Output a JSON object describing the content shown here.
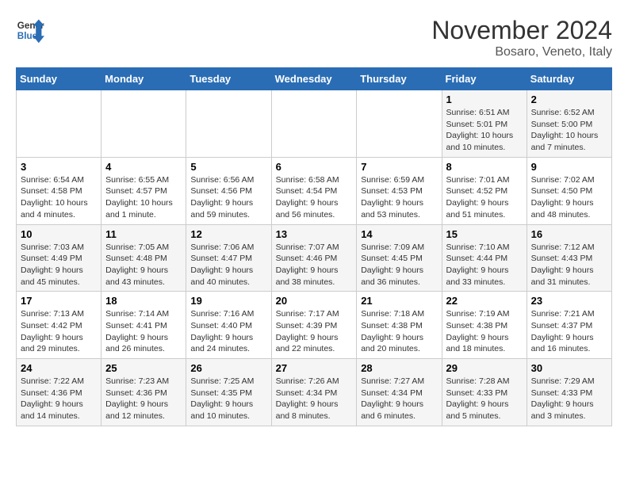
{
  "header": {
    "logo_line1": "General",
    "logo_line2": "Blue",
    "month": "November 2024",
    "location": "Bosaro, Veneto, Italy"
  },
  "weekdays": [
    "Sunday",
    "Monday",
    "Tuesday",
    "Wednesday",
    "Thursday",
    "Friday",
    "Saturday"
  ],
  "weeks": [
    [
      {
        "day": "",
        "info": ""
      },
      {
        "day": "",
        "info": ""
      },
      {
        "day": "",
        "info": ""
      },
      {
        "day": "",
        "info": ""
      },
      {
        "day": "",
        "info": ""
      },
      {
        "day": "1",
        "info": "Sunrise: 6:51 AM\nSunset: 5:01 PM\nDaylight: 10 hours and 10 minutes."
      },
      {
        "day": "2",
        "info": "Sunrise: 6:52 AM\nSunset: 5:00 PM\nDaylight: 10 hours and 7 minutes."
      }
    ],
    [
      {
        "day": "3",
        "info": "Sunrise: 6:54 AM\nSunset: 4:58 PM\nDaylight: 10 hours and 4 minutes."
      },
      {
        "day": "4",
        "info": "Sunrise: 6:55 AM\nSunset: 4:57 PM\nDaylight: 10 hours and 1 minute."
      },
      {
        "day": "5",
        "info": "Sunrise: 6:56 AM\nSunset: 4:56 PM\nDaylight: 9 hours and 59 minutes."
      },
      {
        "day": "6",
        "info": "Sunrise: 6:58 AM\nSunset: 4:54 PM\nDaylight: 9 hours and 56 minutes."
      },
      {
        "day": "7",
        "info": "Sunrise: 6:59 AM\nSunset: 4:53 PM\nDaylight: 9 hours and 53 minutes."
      },
      {
        "day": "8",
        "info": "Sunrise: 7:01 AM\nSunset: 4:52 PM\nDaylight: 9 hours and 51 minutes."
      },
      {
        "day": "9",
        "info": "Sunrise: 7:02 AM\nSunset: 4:50 PM\nDaylight: 9 hours and 48 minutes."
      }
    ],
    [
      {
        "day": "10",
        "info": "Sunrise: 7:03 AM\nSunset: 4:49 PM\nDaylight: 9 hours and 45 minutes."
      },
      {
        "day": "11",
        "info": "Sunrise: 7:05 AM\nSunset: 4:48 PM\nDaylight: 9 hours and 43 minutes."
      },
      {
        "day": "12",
        "info": "Sunrise: 7:06 AM\nSunset: 4:47 PM\nDaylight: 9 hours and 40 minutes."
      },
      {
        "day": "13",
        "info": "Sunrise: 7:07 AM\nSunset: 4:46 PM\nDaylight: 9 hours and 38 minutes."
      },
      {
        "day": "14",
        "info": "Sunrise: 7:09 AM\nSunset: 4:45 PM\nDaylight: 9 hours and 36 minutes."
      },
      {
        "day": "15",
        "info": "Sunrise: 7:10 AM\nSunset: 4:44 PM\nDaylight: 9 hours and 33 minutes."
      },
      {
        "day": "16",
        "info": "Sunrise: 7:12 AM\nSunset: 4:43 PM\nDaylight: 9 hours and 31 minutes."
      }
    ],
    [
      {
        "day": "17",
        "info": "Sunrise: 7:13 AM\nSunset: 4:42 PM\nDaylight: 9 hours and 29 minutes."
      },
      {
        "day": "18",
        "info": "Sunrise: 7:14 AM\nSunset: 4:41 PM\nDaylight: 9 hours and 26 minutes."
      },
      {
        "day": "19",
        "info": "Sunrise: 7:16 AM\nSunset: 4:40 PM\nDaylight: 9 hours and 24 minutes."
      },
      {
        "day": "20",
        "info": "Sunrise: 7:17 AM\nSunset: 4:39 PM\nDaylight: 9 hours and 22 minutes."
      },
      {
        "day": "21",
        "info": "Sunrise: 7:18 AM\nSunset: 4:38 PM\nDaylight: 9 hours and 20 minutes."
      },
      {
        "day": "22",
        "info": "Sunrise: 7:19 AM\nSunset: 4:38 PM\nDaylight: 9 hours and 18 minutes."
      },
      {
        "day": "23",
        "info": "Sunrise: 7:21 AM\nSunset: 4:37 PM\nDaylight: 9 hours and 16 minutes."
      }
    ],
    [
      {
        "day": "24",
        "info": "Sunrise: 7:22 AM\nSunset: 4:36 PM\nDaylight: 9 hours and 14 minutes."
      },
      {
        "day": "25",
        "info": "Sunrise: 7:23 AM\nSunset: 4:36 PM\nDaylight: 9 hours and 12 minutes."
      },
      {
        "day": "26",
        "info": "Sunrise: 7:25 AM\nSunset: 4:35 PM\nDaylight: 9 hours and 10 minutes."
      },
      {
        "day": "27",
        "info": "Sunrise: 7:26 AM\nSunset: 4:34 PM\nDaylight: 9 hours and 8 minutes."
      },
      {
        "day": "28",
        "info": "Sunrise: 7:27 AM\nSunset: 4:34 PM\nDaylight: 9 hours and 6 minutes."
      },
      {
        "day": "29",
        "info": "Sunrise: 7:28 AM\nSunset: 4:33 PM\nDaylight: 9 hours and 5 minutes."
      },
      {
        "day": "30",
        "info": "Sunrise: 7:29 AM\nSunset: 4:33 PM\nDaylight: 9 hours and 3 minutes."
      }
    ]
  ]
}
